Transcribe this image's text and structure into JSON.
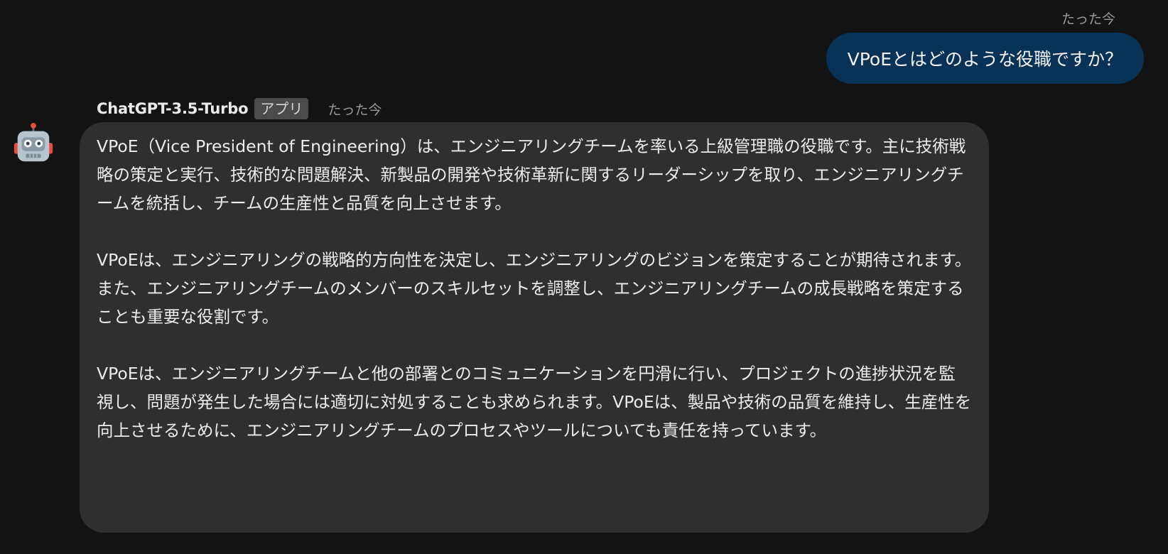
{
  "user_message": {
    "timestamp": "たった今",
    "text": "VPoEとはどのような役職ですか？"
  },
  "bot_message": {
    "avatar_icon": "robot-icon",
    "name": "ChatGPT-3.5-Turbo",
    "badge": "アプリ",
    "timestamp": "たった今",
    "paragraphs": [
      "VPoE（Vice President of Engineering）は、エンジニアリングチームを率いる上級管理職の役職です。主に技術戦略の策定と実行、技術的な問題解決、新製品の開発や技術革新に関するリーダーシップを取り、エンジニアリングチームを統括し、チームの生産性と品質を向上させます。",
      "VPoEは、エンジニアリングの戦略的方向性を決定し、エンジニアリングのビジョンを策定することが期待されます。また、エンジニアリングチームのメンバーのスキルセットを調整し、エンジニアリングチームの成長戦略を策定することも重要な役割です。",
      "VPoEは、エンジニアリングチームと他の部署とのコミュニケーションを円滑に行い、プロジェクトの進捗状況を監視し、問題が発生した場合には適切に対処することも求められます。VPoEは、製品や技術の品質を維持し、生産性を向上させるために、エンジニアリングチームのプロセスやツールについても責任を持っています。"
    ]
  }
}
